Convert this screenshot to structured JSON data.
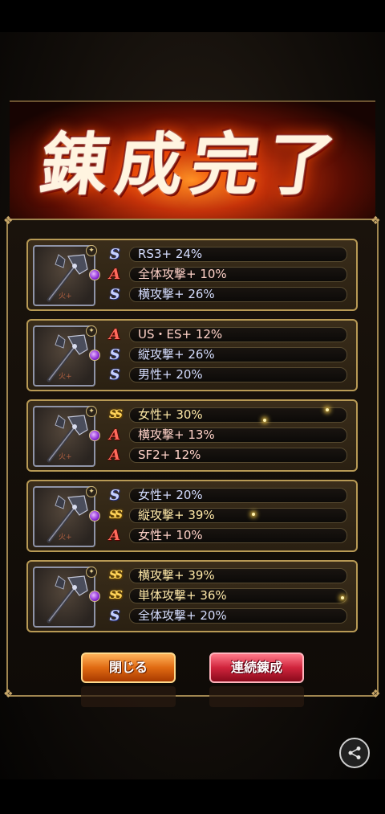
{
  "title": "錬成完了",
  "results": [
    {
      "weapon_tag": "火+",
      "abilities": [
        {
          "rank": "S",
          "text": "RS3+ 24%"
        },
        {
          "rank": "A",
          "text": "全体攻撃+ 10%"
        },
        {
          "rank": "S",
          "text": "横攻撃+ 26%"
        }
      ]
    },
    {
      "weapon_tag": "火+",
      "abilities": [
        {
          "rank": "A",
          "text": "US・ES+ 12%"
        },
        {
          "rank": "S",
          "text": "縦攻撃+ 26%"
        },
        {
          "rank": "S",
          "text": "男性+ 20%"
        }
      ]
    },
    {
      "weapon_tag": "火+",
      "abilities": [
        {
          "rank": "SS",
          "text": "女性+ 30%"
        },
        {
          "rank": "A",
          "text": "横攻撃+ 13%"
        },
        {
          "rank": "A",
          "text": "SF2+ 12%"
        }
      ]
    },
    {
      "weapon_tag": "火+",
      "abilities": [
        {
          "rank": "S",
          "text": "女性+ 20%"
        },
        {
          "rank": "SS",
          "text": "縦攻撃+ 39%"
        },
        {
          "rank": "A",
          "text": "女性+ 10%"
        }
      ]
    },
    {
      "weapon_tag": "",
      "abilities": [
        {
          "rank": "SS",
          "text": "横攻撃+ 39%"
        },
        {
          "rank": "SS",
          "text": "単体攻撃+ 36%"
        },
        {
          "rank": "S",
          "text": "全体攻撃+ 20%"
        }
      ]
    }
  ],
  "buttons": {
    "close": "閉じる",
    "continue": "連続錬成"
  },
  "colors": {
    "rank_s": "#c6d0ff",
    "rank_a": "#ff6a5c",
    "rank_ss": "#ffd45a",
    "frame_gold": "#b89a55"
  },
  "icons": [
    "axe-weapon-icon",
    "purple-gem-icon",
    "share-icon"
  ]
}
